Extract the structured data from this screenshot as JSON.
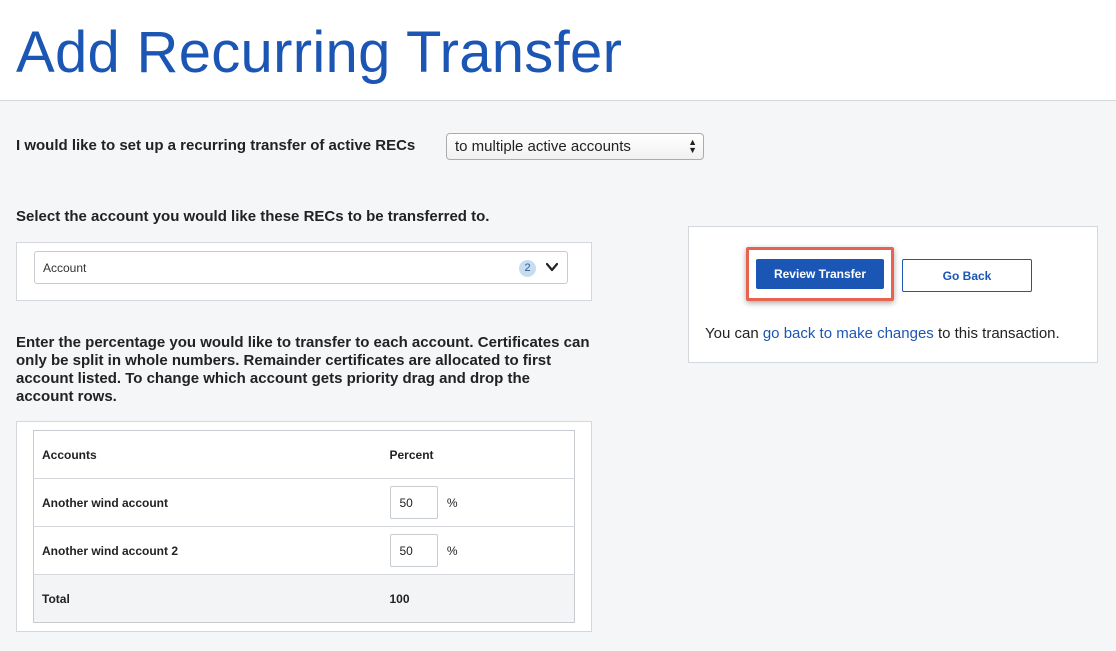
{
  "header": {
    "title": "Add Recurring Transfer"
  },
  "transfer_mode": {
    "label": "I would like to set up a recurring transfer of active RECs",
    "selected": "to multiple active accounts"
  },
  "account_section": {
    "label": "Select the account you would like these RECs to be transferred to.",
    "dropdown_label": "Account",
    "selected_count": "2"
  },
  "instructions": "Enter the percentage you would like to transfer to each account. Certificates can only be split in whole numbers. Remainder certificates are allocated to first account listed. To change which account gets priority drag and drop the account rows.",
  "table": {
    "headers": [
      "Accounts",
      "Percent"
    ],
    "rows": [
      {
        "account": "Another wind account",
        "percent": "50",
        "unit": "%"
      },
      {
        "account": "Another wind account 2",
        "percent": "50",
        "unit": "%"
      }
    ],
    "total_label": "Total",
    "total_value": "100"
  },
  "panel": {
    "review_label": "Review Transfer",
    "goback_label": "Go Back",
    "note_prefix": "You can ",
    "note_link": "go back to make changes",
    "note_suffix": " to this transaction."
  },
  "colors": {
    "brand_blue": "#1b56b5",
    "highlight": "#e8634f",
    "badge": "#c9dcef"
  }
}
